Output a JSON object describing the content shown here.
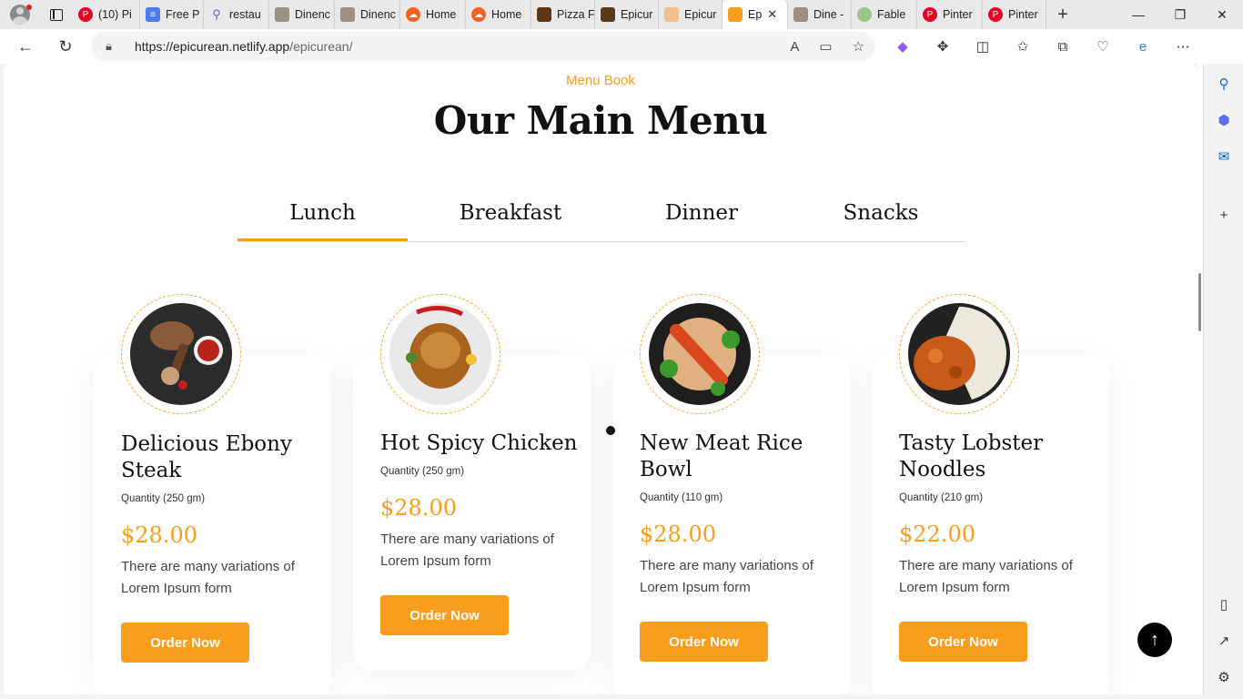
{
  "browser": {
    "tabs": [
      {
        "label": "(10) Pi",
        "color": "#e60023"
      },
      {
        "label": "Free P",
        "color": "#4b7bec"
      },
      {
        "label": "restau",
        "color": "#888888"
      },
      {
        "label": "Dinenc",
        "color": "#9b8f80"
      },
      {
        "label": "Dinenc",
        "color": "#9b8f80"
      },
      {
        "label": "Home",
        "color": "#f26322"
      },
      {
        "label": "Home",
        "color": "#f26322"
      },
      {
        "label": "Pizza F",
        "color": "#5a3a1a"
      },
      {
        "label": "Epicur",
        "color": "#5a3a1a"
      },
      {
        "label": "Epicur",
        "color": "#f0c08a"
      },
      {
        "label": "Ep",
        "color": "#f99d1c"
      },
      {
        "label": "Dine -",
        "color": "#9b8f80"
      },
      {
        "label": "Fable",
        "color": "#9cc58a"
      },
      {
        "label": "Pinter",
        "color": "#e60023"
      },
      {
        "label": "Pinter",
        "color": "#e60023"
      }
    ],
    "url_host": "https://epicurean.netlify.app",
    "url_path": "/epicurean/"
  },
  "section": {
    "kicker": "Menu Book",
    "title": "Our Main Menu"
  },
  "menu_tabs": [
    "Lunch",
    "Breakfast",
    "Dinner",
    "Snacks"
  ],
  "active_tab": "Lunch",
  "cards": [
    {
      "name": "Delicious Ebony Steak",
      "quantity": "Quantity (250 gm)",
      "price": "$28.00",
      "desc": "There are many variations of Lorem Ipsum form",
      "button": "Order Now"
    },
    {
      "name": "Hot Spicy Chicken",
      "quantity": "Quantity (250 gm)",
      "price": "$28.00",
      "desc": "There are many variations of Lorem Ipsum form",
      "button": "Order Now"
    },
    {
      "name": "New Meat Rice Bowl",
      "quantity": "Quantity (110 gm)",
      "price": "$28.00",
      "desc": "There are many variations of Lorem Ipsum form",
      "button": "Order Now"
    },
    {
      "name": "Tasty Lobster Noodles",
      "quantity": "Quantity (210 gm)",
      "price": "$22.00",
      "desc": "There are many variations of Lorem Ipsum form",
      "button": "Order Now"
    }
  ],
  "colors": {
    "accent": "#f99d1c",
    "text": "#111111"
  }
}
